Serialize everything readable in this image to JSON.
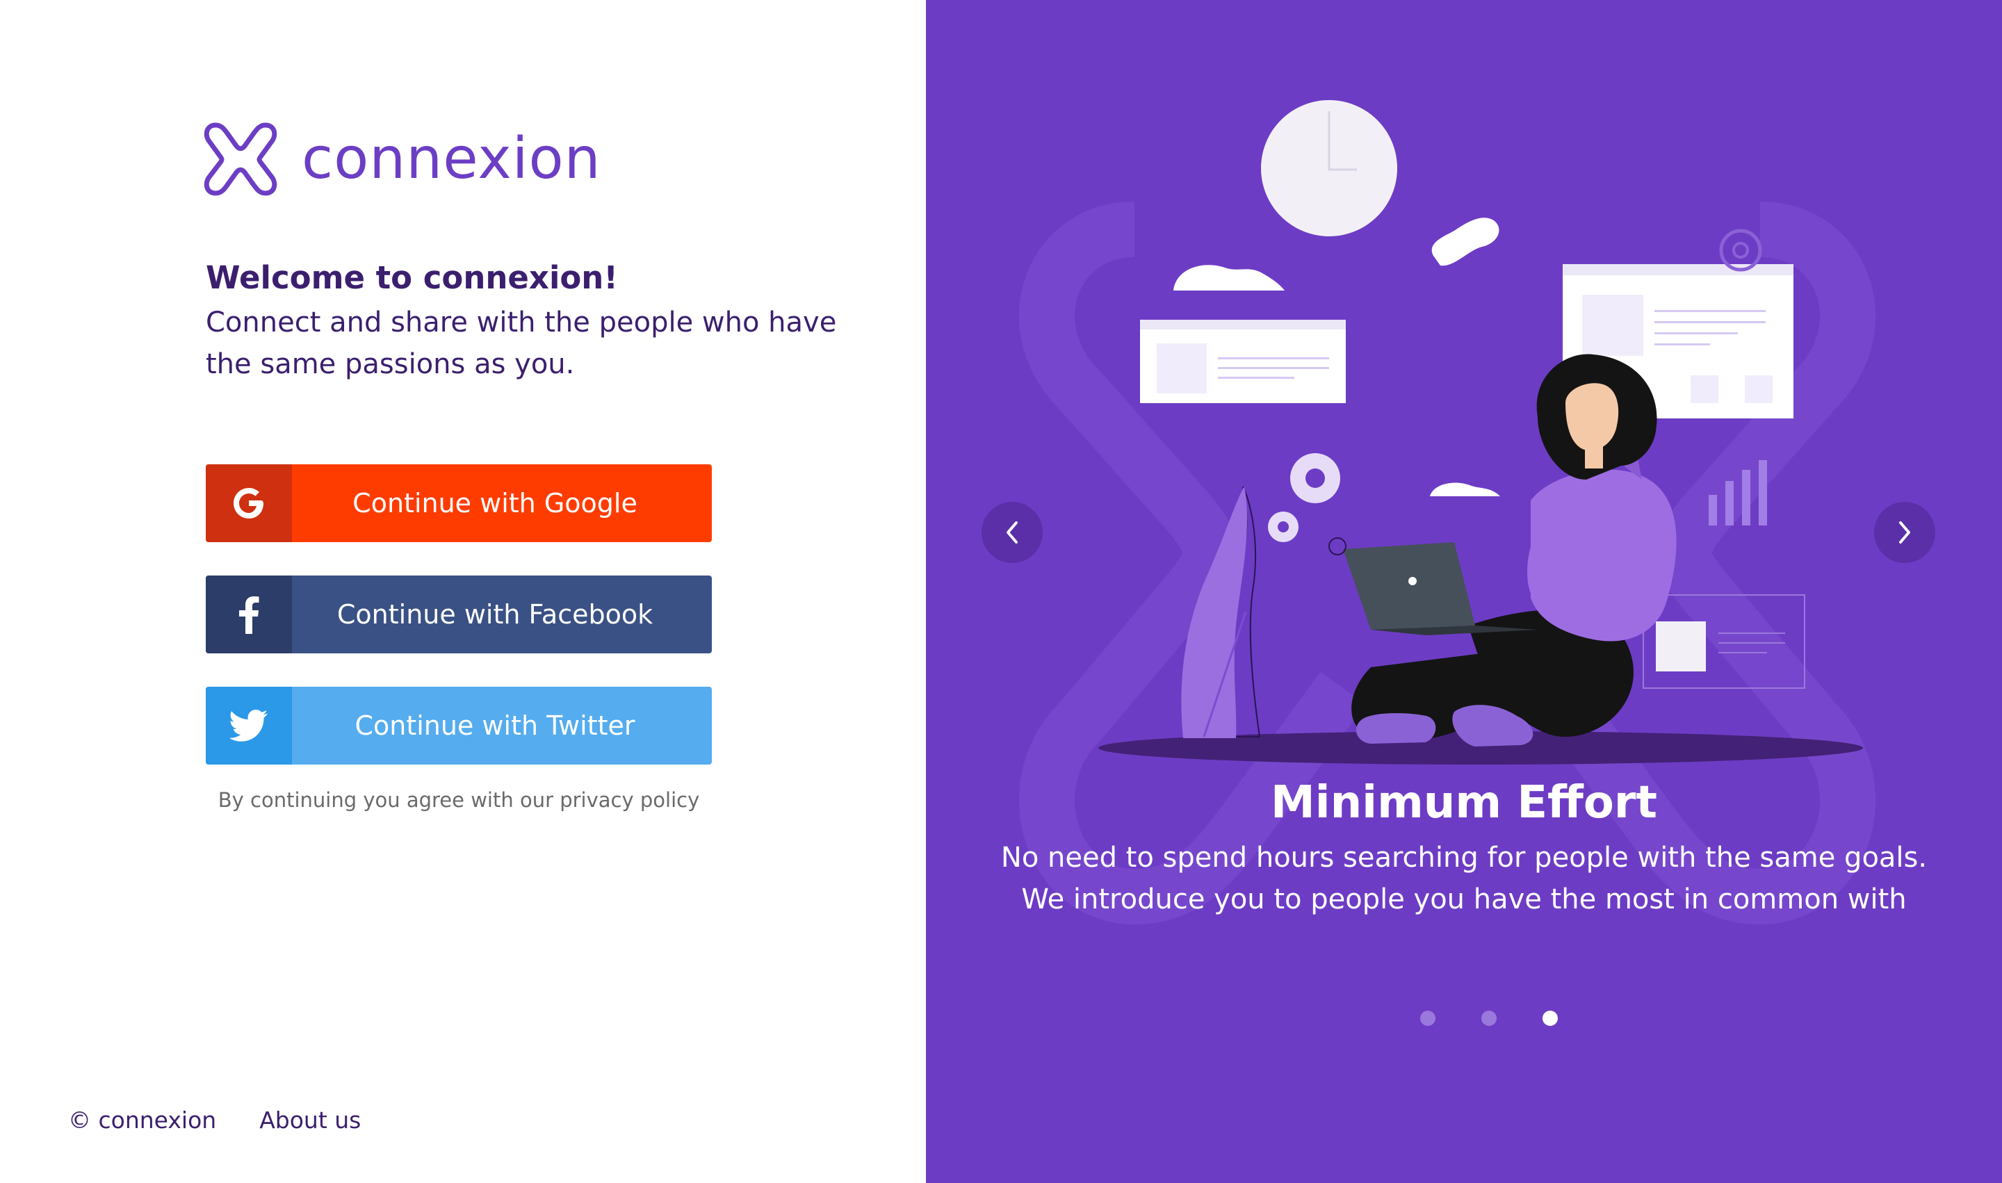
{
  "brand": {
    "name": "connexion",
    "color": "#6c3ec4"
  },
  "welcome": {
    "title": "Welcome to connexion!",
    "text": "Connect and share with the people who have the same passions as you."
  },
  "auth": {
    "google_label": "Continue with Google",
    "facebook_label": "Continue with Facebook",
    "twitter_label": "Continue with Twitter",
    "google_color": "#ff3c00",
    "facebook_color": "#3a5185",
    "twitter_color": "#55acee",
    "policy_text": "By continuing you agree with our privacy policy"
  },
  "footer": {
    "copyright": "© connexion",
    "about": "About us"
  },
  "carousel": {
    "title": "Minimum Effort",
    "text": "No need to spend hours searching for people with the same goals. We introduce you to people you have the most in common with",
    "slide_count": 3,
    "active_slide": 3,
    "background_color": "#6d3cc5",
    "icons": {
      "prev": "chevron-left-icon",
      "next": "chevron-right-icon"
    }
  }
}
